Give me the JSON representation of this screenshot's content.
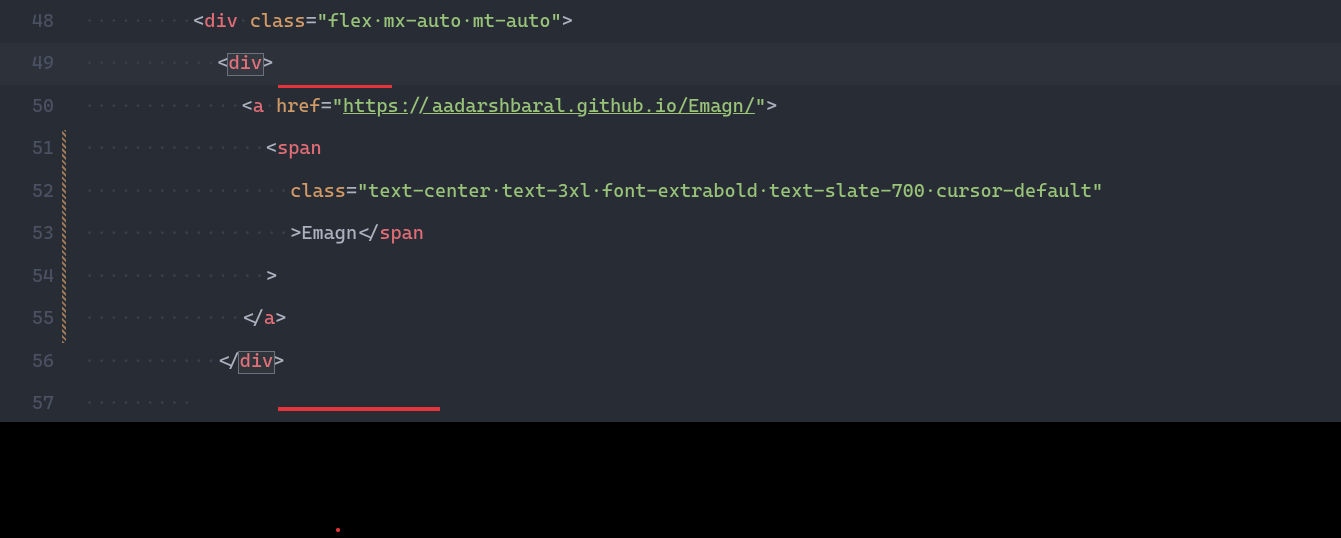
{
  "editor": {
    "lineNumbers": [
      "48",
      "49",
      "50",
      "51",
      "52",
      "53",
      "54",
      "55",
      "56",
      "57"
    ],
    "code": {
      "l48": {
        "ws": "·········",
        "open": "<",
        "tag": "div",
        "sp": "·",
        "attrName": "class",
        "eq": "=",
        "q1": "\"",
        "attrVal": "flex·mx-auto·mt-auto",
        "q2": "\"",
        "close": ">"
      },
      "l49": {
        "ws": "···········",
        "open": "<",
        "tag": "div",
        "close": ">"
      },
      "l50": {
        "ws": "·············",
        "open": "<",
        "tag": "a",
        "sp": "·",
        "attrName": "href",
        "eq": "=",
        "q1": "\"",
        "url": "https://aadarshbaral.github.io/Emagn/",
        "q2": "\"",
        "close": ">"
      },
      "l51": {
        "ws": "···············",
        "open": "<",
        "tag": "span"
      },
      "l52": {
        "ws": "·················",
        "attrName": "class",
        "eq": "=",
        "q1": "\"",
        "attrVal": "text-center·text-3xl·font-extrabold·text-slate-700·cursor-default",
        "q2": "\""
      },
      "l53": {
        "ws": "·················",
        "gt": ">",
        "text": "Emagn",
        "open": "</",
        "tag": "span"
      },
      "l54": {
        "ws": "···············",
        "gt": ">"
      },
      "l55": {
        "ws": "·············",
        "open": "</",
        "tag": "a",
        "close": ">"
      },
      "l56": {
        "ws": "···········",
        "open": "</",
        "tag": "div",
        "close": ">"
      },
      "l57": {
        "ws": "·········"
      }
    }
  }
}
